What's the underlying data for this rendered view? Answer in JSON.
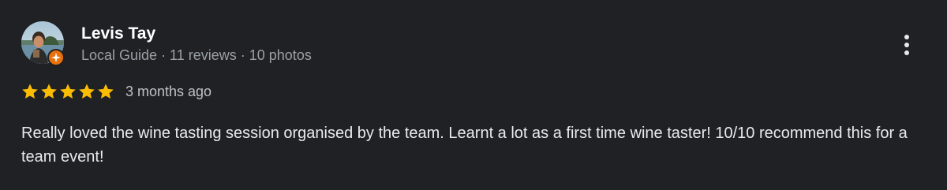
{
  "reviewer": {
    "name": "Levis Tay",
    "meta": "Local Guide · 11 reviews · 10 photos"
  },
  "review": {
    "rating": 5,
    "rating_max": 5,
    "date": "3 months ago",
    "text": "Really loved the wine tasting session organised by the team. Learnt a lot as a first time wine taster! 10/10 recommend this for a team event!"
  },
  "colors": {
    "background": "#202124",
    "star": "#fbbc04",
    "badge": "#e8710a",
    "meta_text": "#9aa0a6"
  },
  "icons": {
    "more": "more-vert-icon",
    "badge": "local-guide-badge-icon",
    "star": "star-icon"
  }
}
